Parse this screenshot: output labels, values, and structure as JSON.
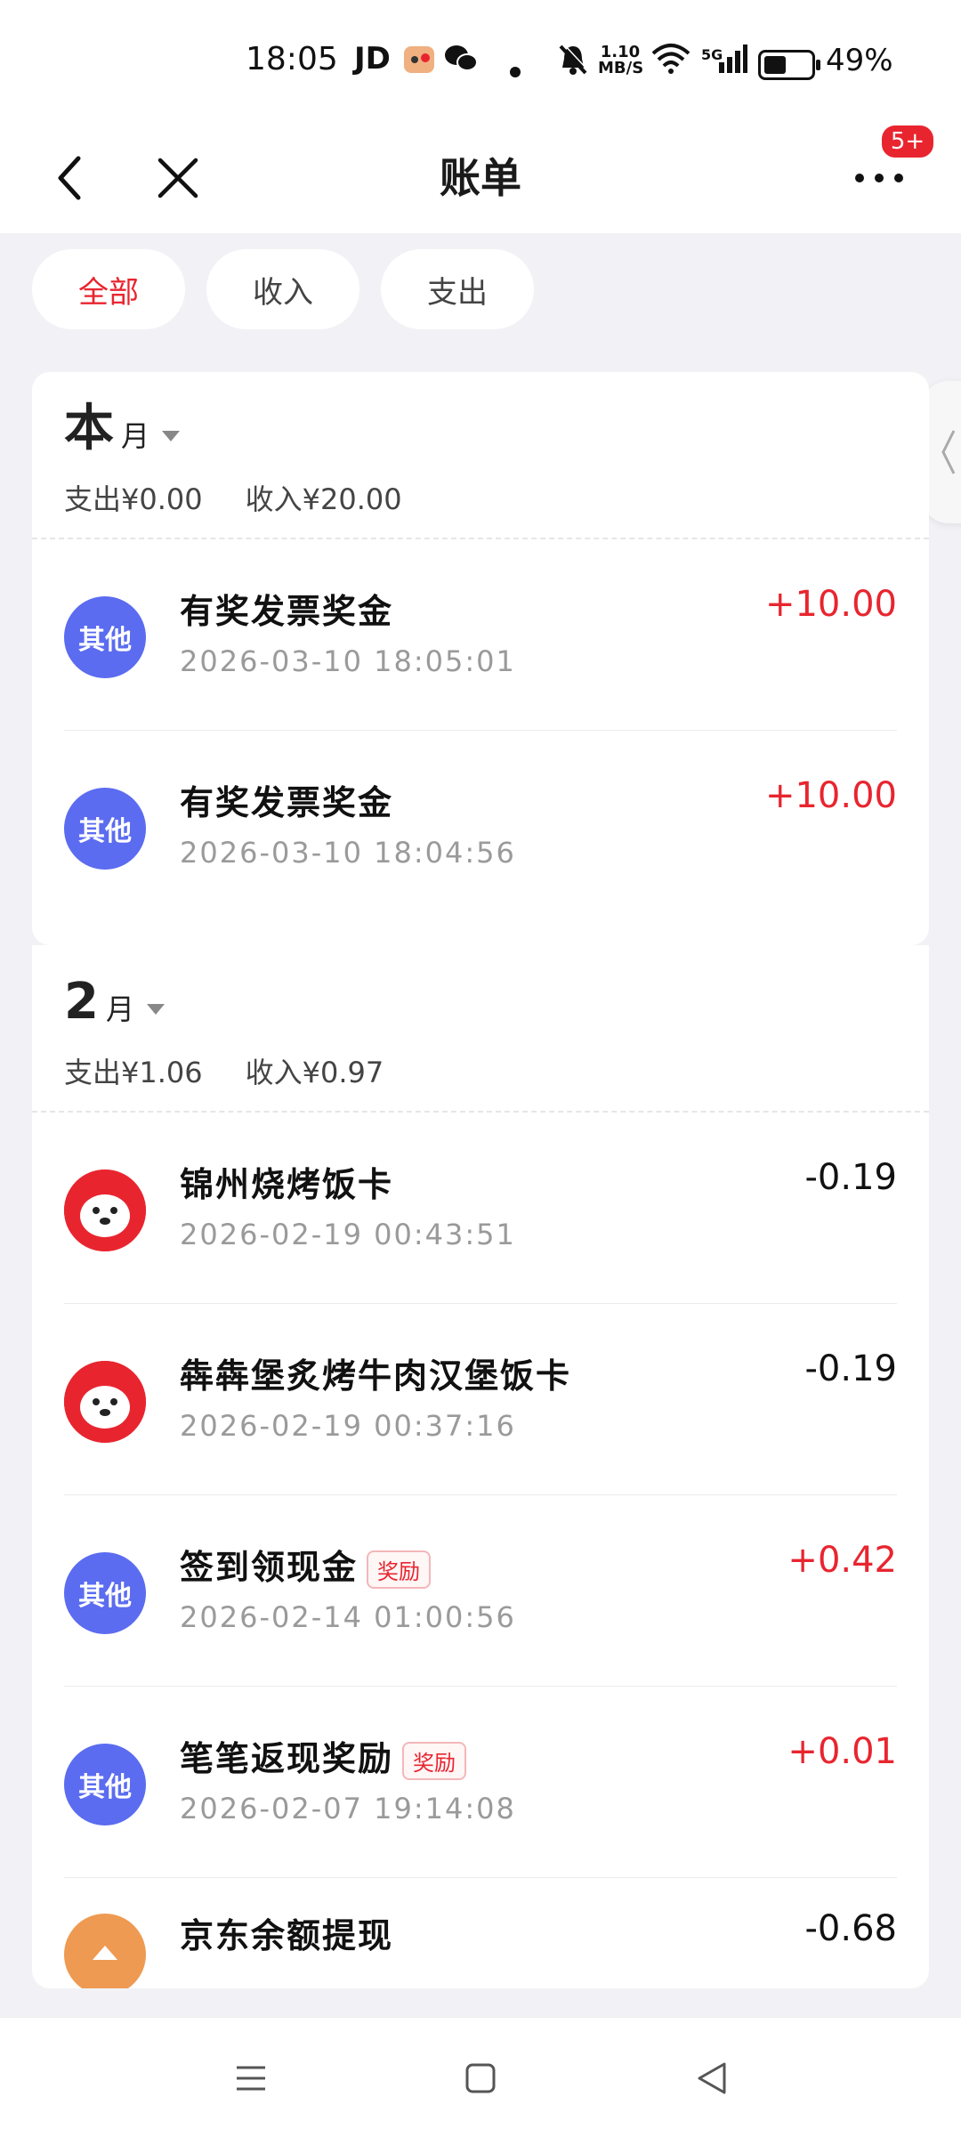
{
  "status_bar": {
    "time": "18:05",
    "app_label": "JD",
    "network_speed": "1.10 MB/S",
    "network_type": "5G",
    "battery": "49%",
    "battery_level": 0.49
  },
  "header": {
    "title": "账单",
    "notification_badge": "5+"
  },
  "filters": {
    "tabs": [
      "全部",
      "收入",
      "支出"
    ],
    "active": "全部"
  },
  "sections": [
    {
      "month_num": "本",
      "month_unit": "月",
      "expense": "支出¥0.00",
      "income": "收入¥20.00",
      "items": [
        {
          "icon_label": "其他",
          "name": "有奖发票奖金",
          "time": "2026-03-10 18:05:01",
          "amount": "+10.00"
        },
        {
          "icon_label": "其他",
          "name": "有奖发票奖金",
          "time": "2026-03-10 18:04:56",
          "amount": "+10.00"
        }
      ]
    },
    {
      "month_num": "2",
      "month_unit": "月",
      "expense": "支出¥1.06",
      "income": "收入¥0.97",
      "items": [
        {
          "icon": "jd-mascot-icon",
          "name": "锦州烧烤饭卡",
          "time": "2026-02-19 00:43:51",
          "amount": "-0.19"
        },
        {
          "icon": "jd-mascot-icon",
          "name": "犇犇堡炙烤牛肉汉堡饭卡",
          "time": "2026-02-19 00:37:16",
          "amount": "-0.19"
        },
        {
          "icon_label": "其他",
          "name": "签到领现金",
          "tag": "奖励",
          "time": "2026-02-14 01:00:56",
          "amount": "+0.42"
        },
        {
          "icon_label": "其他",
          "name": "笔笔返现奖励",
          "tag": "奖励",
          "time": "2026-02-07 19:14:08",
          "amount": "+0.01"
        },
        {
          "icon": "wallet-icon",
          "name": "京东余额提现",
          "time": "",
          "amount": "-0.68"
        }
      ]
    }
  ],
  "colors": {
    "accent_red": "#e8252f",
    "other_icon_blue": "#5b6cf0",
    "background": "#f2f2f6"
  }
}
